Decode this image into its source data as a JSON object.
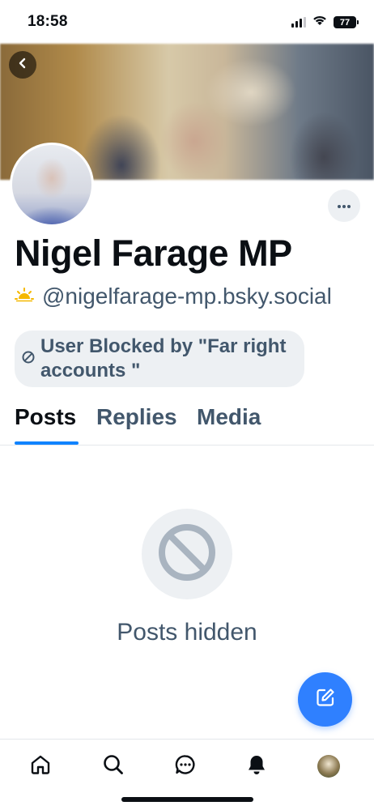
{
  "status_bar": {
    "time": "18:58",
    "battery": "77"
  },
  "profile": {
    "display_name": "Nigel Farage MP",
    "handle": "@nigelfarage-mp.bsky.social",
    "blocked_label": "User Blocked by \"Far right accounts  \""
  },
  "tabs": [
    {
      "label": "Posts",
      "active": true
    },
    {
      "label": "Replies",
      "active": false
    },
    {
      "label": "Media",
      "active": false
    }
  ],
  "empty_state": {
    "message": "Posts hidden"
  },
  "icons": {
    "back": "chevron-left-icon",
    "more": "ellipsis-icon",
    "handle_badge": "sun-icon",
    "blocked": "block-icon",
    "compose": "compose-icon",
    "nav": [
      "home-icon",
      "search-icon",
      "chat-icon",
      "bell-icon",
      "avatar"
    ]
  },
  "colors": {
    "accent": "#1083fe",
    "fab": "#2f80ff",
    "muted_text": "#42576c",
    "chip_bg": "#edf0f3",
    "sun": "#f5b800"
  }
}
